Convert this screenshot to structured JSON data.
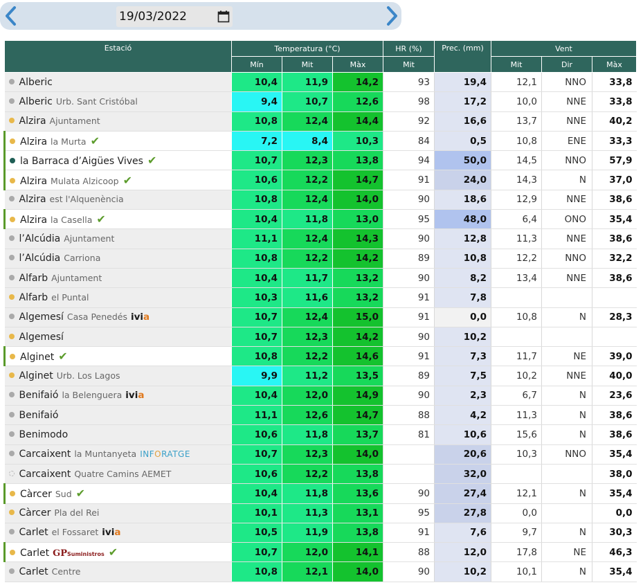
{
  "date": "19/03/2022",
  "headers": {
    "station": "Estació",
    "temperature": "Temperatura (°C)",
    "hr": "HR (%)",
    "prec": "Prec. (mm)",
    "wind": "Vent",
    "min": "Mín",
    "mit": "Mit",
    "max": "Màx",
    "dir": "Dir"
  },
  "colors": {
    "header_bg": "#2f665d",
    "temp_cyan": "#29f6f4",
    "temp_light_green": "#1ee887",
    "temp_green": "#17d95a",
    "temp_dark_green": "#14c22e",
    "prec_light": "#dfe4f2",
    "prec_mid": "#c9d2ea",
    "prec_strong": "#b0c3ee",
    "check_green": "#5c9c2c"
  },
  "rows": [
    {
      "name": "Alberic",
      "sub": "",
      "dot": "grey",
      "check": false,
      "logo": "",
      "min": "10,4",
      "mit": "11,9",
      "max": "14,2",
      "hr": "93",
      "prec": "19,4",
      "wmit": "12,1",
      "wdir": "NNO",
      "wmax": "33,8"
    },
    {
      "name": "Alberic",
      "sub": "Urb. Sant Cristóbal",
      "dot": "grey",
      "check": false,
      "logo": "",
      "min": "9,4",
      "mit": "10,7",
      "max": "12,6",
      "hr": "98",
      "prec": "17,2",
      "wmit": "10,0",
      "wdir": "NNE",
      "wmax": "33,8"
    },
    {
      "name": "Alzira",
      "sub": "Ajuntament",
      "dot": "yellow",
      "check": false,
      "logo": "",
      "min": "10,8",
      "mit": "12,4",
      "max": "14,4",
      "hr": "92",
      "prec": "16,6",
      "wmit": "13,7",
      "wdir": "NNE",
      "wmax": "40,2"
    },
    {
      "name": "Alzira",
      "sub": "la Murta",
      "dot": "yellow",
      "check": true,
      "logo": "",
      "min": "7,2",
      "mit": "8,4",
      "max": "10,3",
      "hr": "84",
      "prec": "0,5",
      "wmit": "10,8",
      "wdir": "ENE",
      "wmax": "33,3"
    },
    {
      "name": "la Barraca d’Aigües Vives",
      "sub": "",
      "dot": "teal",
      "check": true,
      "logo": "",
      "min": "10,7",
      "mit": "12,3",
      "max": "13,8",
      "hr": "94",
      "prec": "50,0",
      "wmit": "14,5",
      "wdir": "NNO",
      "wmax": "57,9"
    },
    {
      "name": "Alzira",
      "sub": "Mulata Alzicoop",
      "dot": "yellow",
      "check": true,
      "logo": "",
      "min": "10,6",
      "mit": "12,2",
      "max": "14,7",
      "hr": "91",
      "prec": "24,0",
      "wmit": "14,3",
      "wdir": "N",
      "wmax": "37,0"
    },
    {
      "name": "Alzira",
      "sub": "est l'Alquenència",
      "dot": "grey",
      "check": false,
      "logo": "",
      "min": "10,8",
      "mit": "12,4",
      "max": "14,0",
      "hr": "90",
      "prec": "18,6",
      "wmit": "12,9",
      "wdir": "NNE",
      "wmax": "38,6"
    },
    {
      "name": "Alzira",
      "sub": "la Casella",
      "dot": "yellow",
      "check": true,
      "logo": "",
      "min": "10,4",
      "mit": "11,8",
      "max": "13,0",
      "hr": "95",
      "prec": "48,0",
      "wmit": "6,4",
      "wdir": "ONO",
      "wmax": "35,4"
    },
    {
      "name": "l’Alcúdia",
      "sub": "Ajuntament",
      "dot": "grey",
      "check": false,
      "logo": "",
      "min": "11,1",
      "mit": "12,4",
      "max": "14,3",
      "hr": "90",
      "prec": "12,8",
      "wmit": "11,3",
      "wdir": "NNE",
      "wmax": "38,6"
    },
    {
      "name": "l’Alcúdia",
      "sub": "Carriona",
      "dot": "grey",
      "check": false,
      "logo": "",
      "min": "10,8",
      "mit": "12,2",
      "max": "14,2",
      "hr": "89",
      "prec": "10,8",
      "wmit": "12,2",
      "wdir": "NNO",
      "wmax": "32,2"
    },
    {
      "name": "Alfarb",
      "sub": "Ajuntament",
      "dot": "grey",
      "check": false,
      "logo": "",
      "min": "10,4",
      "mit": "11,7",
      "max": "13,2",
      "hr": "90",
      "prec": "8,2",
      "wmit": "13,4",
      "wdir": "NNE",
      "wmax": "38,6"
    },
    {
      "name": "Alfarb",
      "sub": "el Puntal",
      "dot": "yellow",
      "check": false,
      "logo": "",
      "min": "10,3",
      "mit": "11,6",
      "max": "13,2",
      "hr": "91",
      "prec": "7,8",
      "wmit": "",
      "wdir": "",
      "wmax": ""
    },
    {
      "name": "Algemesí",
      "sub": "Casa Penedés",
      "dot": "grey",
      "check": false,
      "logo": "ivia",
      "min": "10,7",
      "mit": "12,4",
      "max": "15,0",
      "hr": "91",
      "prec": "0,0",
      "wmit": "10,8",
      "wdir": "N",
      "wmax": "28,3"
    },
    {
      "name": "Algemesí",
      "sub": "",
      "dot": "yellow",
      "check": false,
      "logo": "",
      "min": "10,7",
      "mit": "12,3",
      "max": "14,2",
      "hr": "90",
      "prec": "10,2",
      "wmit": "",
      "wdir": "",
      "wmax": ""
    },
    {
      "name": "Alginet",
      "sub": "",
      "dot": "yellow",
      "check": true,
      "logo": "",
      "min": "10,8",
      "mit": "12,2",
      "max": "14,6",
      "hr": "91",
      "prec": "7,3",
      "wmit": "11,7",
      "wdir": "NE",
      "wmax": "39,0"
    },
    {
      "name": "Alginet",
      "sub": "Urb. Los Lagos",
      "dot": "yellow",
      "check": false,
      "logo": "",
      "min": "9,9",
      "mit": "11,2",
      "max": "13,5",
      "hr": "89",
      "prec": "7,5",
      "wmit": "10,2",
      "wdir": "NNE",
      "wmax": "40,0"
    },
    {
      "name": "Benifaió",
      "sub": "la Belenguera",
      "dot": "grey",
      "check": false,
      "logo": "ivia",
      "min": "10,4",
      "mit": "12,0",
      "max": "14,9",
      "hr": "90",
      "prec": "2,3",
      "wmit": "6,7",
      "wdir": "N",
      "wmax": "23,6"
    },
    {
      "name": "Benifaió",
      "sub": "",
      "dot": "grey",
      "check": false,
      "logo": "",
      "min": "11,1",
      "mit": "12,6",
      "max": "14,7",
      "hr": "88",
      "prec": "4,2",
      "wmit": "11,3",
      "wdir": "N",
      "wmax": "38,6"
    },
    {
      "name": "Benimodo",
      "sub": "",
      "dot": "grey",
      "check": false,
      "logo": "",
      "min": "10,6",
      "mit": "11,8",
      "max": "13,7",
      "hr": "81",
      "prec": "10,6",
      "wmit": "15,6",
      "wdir": "N",
      "wmax": "38,6"
    },
    {
      "name": "Carcaixent",
      "sub": "la Muntanyeta",
      "dot": "grey",
      "check": false,
      "logo": "inforatge",
      "min": "10,7",
      "mit": "12,3",
      "max": "14,0",
      "hr": "",
      "prec": "20,6",
      "wmit": "10,3",
      "wdir": "NNO",
      "wmax": "35,4"
    },
    {
      "name": "Carcaixent",
      "sub": "Quatre Camins AEMET",
      "dot": "hollow",
      "check": false,
      "logo": "",
      "min": "10,6",
      "mit": "12,2",
      "max": "13,8",
      "hr": "",
      "prec": "32,0",
      "wmit": "",
      "wdir": "",
      "wmax": "38,0"
    },
    {
      "name": "Càrcer",
      "sub": "Sud",
      "dot": "yellow",
      "check": true,
      "logo": "",
      "min": "10,4",
      "mit": "11,8",
      "max": "13,6",
      "hr": "90",
      "prec": "27,4",
      "wmit": "12,1",
      "wdir": "N",
      "wmax": "35,4"
    },
    {
      "name": "Càrcer",
      "sub": "Pla del Rei",
      "dot": "yellow",
      "check": false,
      "logo": "",
      "min": "10,1",
      "mit": "11,3",
      "max": "13,1",
      "hr": "95",
      "prec": "27,8",
      "wmit": "0,0",
      "wdir": "",
      "wmax": "0,0"
    },
    {
      "name": "Carlet",
      "sub": "el Fossaret",
      "dot": "grey",
      "check": false,
      "logo": "ivia",
      "min": "10,5",
      "mit": "11,9",
      "max": "13,8",
      "hr": "91",
      "prec": "7,6",
      "wmit": "9,7",
      "wdir": "N",
      "wmax": "30,3"
    },
    {
      "name": "Carlet",
      "sub": "",
      "dot": "yellow",
      "check": true,
      "logo": "gp",
      "min": "10,7",
      "mit": "12,0",
      "max": "14,1",
      "hr": "88",
      "prec": "12,0",
      "wmit": "17,8",
      "wdir": "NE",
      "wmax": "46,3"
    },
    {
      "name": "Carlet",
      "sub": "Centre",
      "dot": "grey",
      "check": false,
      "logo": "",
      "min": "10,8",
      "mit": "12,1",
      "max": "14,0",
      "hr": "90",
      "prec": "10,2",
      "wmit": "10,1",
      "wdir": "N",
      "wmax": "35,4"
    }
  ],
  "logos": {
    "ivia_main": "ivi",
    "ivia_accent": "a",
    "inforatge_a": "INF",
    "inforatge_b": "O",
    "inforatge_c": "RATGE",
    "gp_main": "GP",
    "gp_small": "Suministros"
  },
  "check_glyph": "✔"
}
